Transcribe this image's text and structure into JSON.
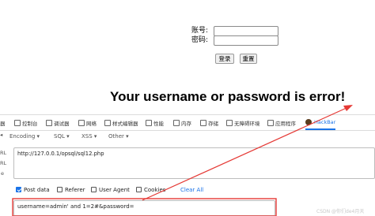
{
  "login": {
    "username_label": "账号:",
    "password_label": "密码:",
    "submit_label": "登录",
    "reset_label": "重置"
  },
  "error_message": "Your username or password is error!",
  "devtools": {
    "tabs": [
      {
        "label": "控制台",
        "icon": "console-icon"
      },
      {
        "label": "调试器",
        "icon": "debugger-icon"
      },
      {
        "label": "网络",
        "icon": "network-icon"
      },
      {
        "label": "样式编辑器",
        "icon": "style-editor-icon"
      },
      {
        "label": "性能",
        "icon": "performance-icon"
      },
      {
        "label": "内存",
        "icon": "memory-icon"
      },
      {
        "label": "存储",
        "icon": "storage-icon"
      },
      {
        "label": "无障碍环境",
        "icon": "accessibility-icon"
      },
      {
        "label": "应用程序",
        "icon": "application-icon"
      },
      {
        "label": "HackBar",
        "icon": "hackbar-icon"
      }
    ],
    "left_cut_label": "器",
    "active_tab": "HackBar"
  },
  "hackbar": {
    "menu": [
      "Encoding",
      "SQL",
      "XSS",
      "Other"
    ],
    "url_value": "http://127.0.0.1/opsql/sql12.php",
    "side_labels": [
      "RL",
      "RL",
      "e"
    ],
    "options": [
      {
        "label": "Post data",
        "checked": true
      },
      {
        "label": "Referer",
        "checked": false
      },
      {
        "label": "User Agent",
        "checked": false
      },
      {
        "label": "Cookies",
        "checked": false
      }
    ],
    "clear_all": "Clear All",
    "post_value": "username=admin' and 1=2#&password="
  },
  "watermark": "CSDN @你们de4月天",
  "colors": {
    "accent": "#1a73e8",
    "annotation_red": "#e53935"
  }
}
